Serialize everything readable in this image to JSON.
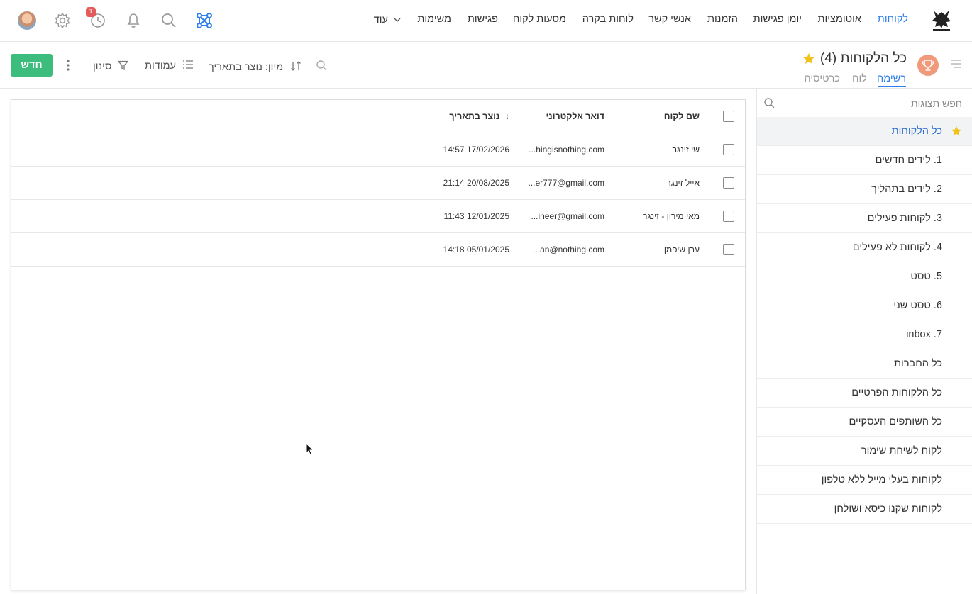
{
  "nav": {
    "items": [
      {
        "label": "לקוחות",
        "active": true
      },
      {
        "label": "אוטומציות"
      },
      {
        "label": "יומן פגישות"
      },
      {
        "label": "הזמנות"
      },
      {
        "label": "אנשי קשר"
      },
      {
        "label": "לוחות בקרה"
      },
      {
        "label": "מסעות לקוח"
      },
      {
        "label": "פגישות"
      },
      {
        "label": "משימות"
      }
    ],
    "more_label": "עוד",
    "history_badge": "1",
    "accent_color": "#2f80ed",
    "icons": [
      "logo-icon",
      "apps-icon",
      "search-icon",
      "bell-icon",
      "history-icon",
      "gear-icon",
      "avatar"
    ]
  },
  "header": {
    "title": "כל הלקוחות (4)",
    "tabs": [
      {
        "label": "רשימה",
        "active": true
      },
      {
        "label": "לוח"
      },
      {
        "label": "כרטיסיה"
      }
    ],
    "new_button": "חדש",
    "filter_label": "סינון",
    "columns_label": "עמודות",
    "sort_label": "מיון: נוצר בתאריך",
    "new_button_color": "#3dbd7d"
  },
  "sidebar": {
    "search_placeholder": "חפש תצוגות",
    "items": [
      {
        "label": "כל הלקוחות",
        "active": true,
        "starred": true
      },
      {
        "label": "1. לידים חדשים"
      },
      {
        "label": "2. לידים בתהליך"
      },
      {
        "label": "3. לקוחות פעילים"
      },
      {
        "label": "4. לקוחות לא פעילים"
      },
      {
        "label": "5. טסט"
      },
      {
        "label": "6. טסט שני"
      },
      {
        "label": "7. inbox"
      },
      {
        "label": "כל החברות"
      },
      {
        "label": "כל הלקוחות הפרטיים"
      },
      {
        "label": "כל השותפים העסקיים"
      },
      {
        "label": "לקוח לשיחת שימור"
      },
      {
        "label": "לקוחות בעלי מייל ללא טלפון"
      },
      {
        "label": "לקוחות שקנו כיסא ושולחן"
      }
    ]
  },
  "table": {
    "columns": {
      "name": "שם לקוח",
      "email": "דואר אלקטרוני",
      "created": "נוצר בתאריך"
    },
    "sort_arrow": "↓",
    "rows": [
      {
        "name": "שי זינגר",
        "email": "...hingisnothing.com",
        "created": "14:57 17/02/2026"
      },
      {
        "name": "אייל זינגר",
        "email": "...er777@gmail.com",
        "created": "21:14 20/08/2025"
      },
      {
        "name": "מאי מירון - זינגר",
        "email": "...ineer@gmail.com",
        "created": "11:43 12/01/2025"
      },
      {
        "name": "ערן שיפמן",
        "email": "...an@nothing.com",
        "created": "14:18 05/01/2025"
      }
    ]
  }
}
